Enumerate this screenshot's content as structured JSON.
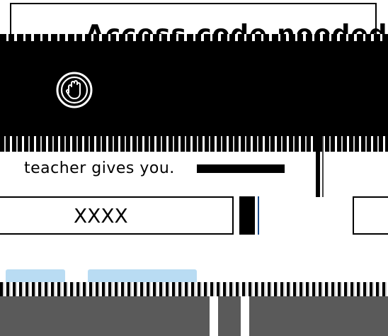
{
  "dialog": {
    "title": "Access code needed",
    "description_line2": "teacher gives you.",
    "code_input": {
      "placeholder": "XXXX"
    },
    "icon": "hand-stop-icon"
  },
  "buttons": {
    "exit_label": "",
    "continue_label": ""
  },
  "colors": {
    "button_bg": "#b9dcf3",
    "band": "#000000",
    "footer": "#5a5a5a"
  }
}
